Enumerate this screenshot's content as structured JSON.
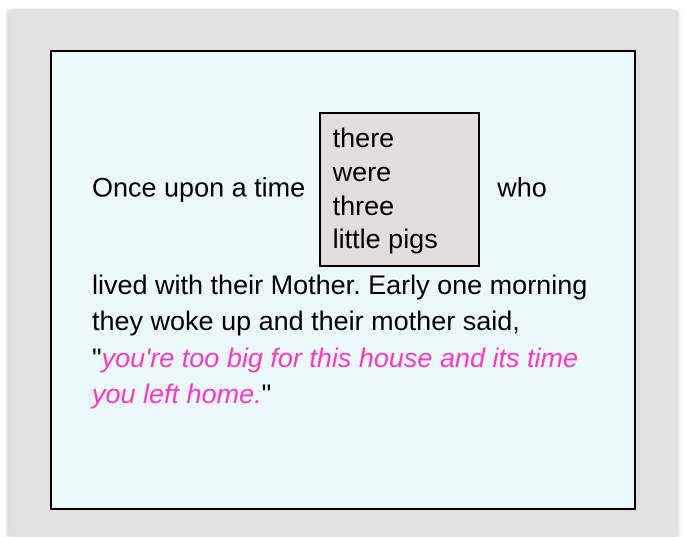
{
  "story": {
    "lead": "Once upon a time",
    "after_box": " who",
    "box_lines": {
      "l1": "there",
      "l2": "were",
      "l3": "three",
      "l4": "little pigs"
    },
    "tail": "lived with their Mother. Early one morning they woke up and their mother said, \"",
    "quote": "you're too big for this house and its time you left home.",
    "tail_close": "\""
  },
  "colors": {
    "panel_bg": "#ecf9fa",
    "outer_bg": "#e1e1e1",
    "box_bg": "#e3ddde",
    "quote_color": "#ff33cc"
  }
}
